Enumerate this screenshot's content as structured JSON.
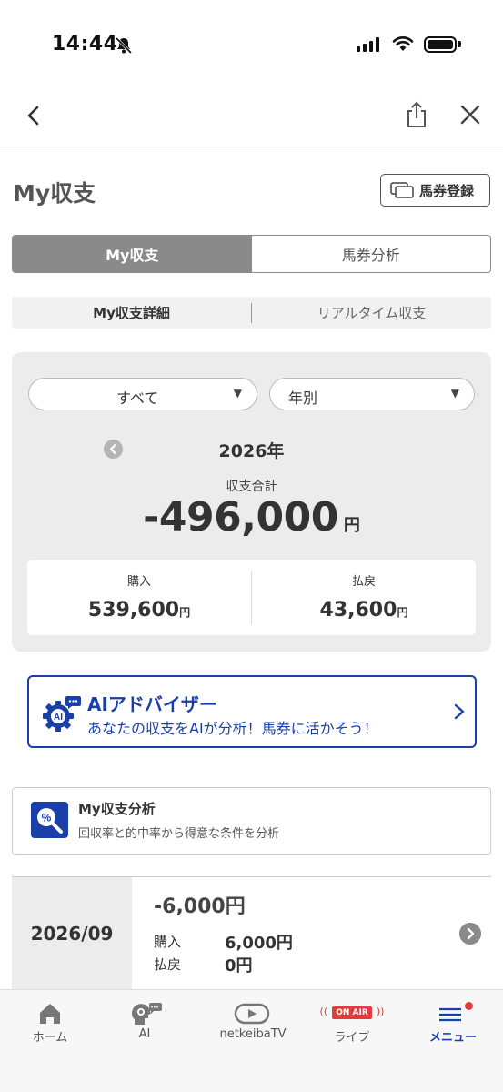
{
  "status_bar": {
    "time": "14:44"
  },
  "header": {
    "title": "My収支",
    "register_label": "馬券登録"
  },
  "main_tabs": [
    {
      "label": "My収支",
      "active": true
    },
    {
      "label": "馬券分析",
      "active": false
    }
  ],
  "sub_tabs": [
    {
      "label": "My収支詳細",
      "active": true
    },
    {
      "label": "リアルタイム収支",
      "active": false
    }
  ],
  "summary": {
    "filter_all": "すべて",
    "filter_period": "年別",
    "year": "2026年",
    "total_label": "収支合計",
    "total_amount": "-496,000",
    "total_unit": "円",
    "purchase_label": "購入",
    "purchase_amount": "539,600",
    "payout_label": "払戻",
    "payout_amount": "43,600",
    "unit": "円"
  },
  "ai_banner": {
    "title": "AIアドバイザー",
    "subtitle": "あなたの収支をAIが分析！馬券に活かそう！",
    "icon_text": "AI"
  },
  "analysis": {
    "title": "My収支分析",
    "subtitle": "回収率と的中率から得意な条件を分析",
    "icon_text": "%"
  },
  "monthly": [
    {
      "month": "2026/09",
      "total": "-6,000円",
      "purchase_label": "購入",
      "purchase": "6,000円",
      "payout_label": "払戻",
      "payout": "0円"
    }
  ],
  "tab_bar": {
    "items": [
      {
        "label": "ホーム",
        "icon": "home-icon"
      },
      {
        "label": "AI",
        "icon": "ai-head-icon"
      },
      {
        "label": "netkeibaTV",
        "icon": "tv-icon"
      },
      {
        "label": "ライブ",
        "icon": "live-icon",
        "badge": "ON AIR"
      },
      {
        "label": "メニュー",
        "icon": "menu-icon",
        "active": true
      }
    ]
  },
  "colors": {
    "accent": "#1a3fa8",
    "segment_active": "#8a8a8a",
    "card_bg": "#ececec",
    "live_red": "#e23b3b"
  }
}
